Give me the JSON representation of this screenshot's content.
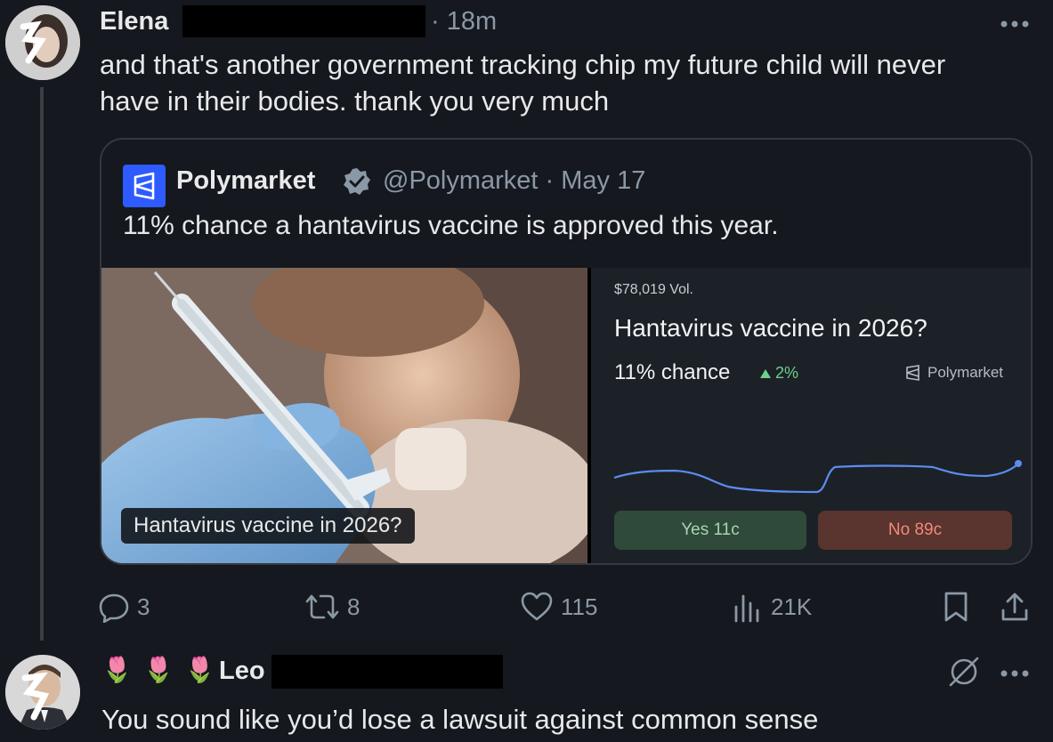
{
  "post": {
    "author": "Elena",
    "time": "18m",
    "text_line1": "and that's another government tracking chip my future child will never",
    "text_line2": "have in their bodies. thank you very much",
    "more_icon": "more-icon"
  },
  "quote": {
    "author": "Polymarket",
    "handle": "@Polymarket",
    "date": "May 17",
    "text": "11% chance a hantavirus vaccine is approved this year.",
    "image_caption": "Hantavirus vaccine in 2026?",
    "market": {
      "volume": "$78,019 Vol.",
      "title": "Hantavirus vaccine in 2026?",
      "chance": "11% chance",
      "delta": "2%",
      "brand": "Polymarket",
      "yes_label": "Yes 11c",
      "no_label": "No 89c"
    }
  },
  "actions": {
    "replies": "3",
    "reposts": "8",
    "likes": "115",
    "views": "21K"
  },
  "reply": {
    "emojis": "🌷 🌷 🌷",
    "author": "Leo",
    "text": "You sound like you’d lose a lawsuit against common sense"
  },
  "colors": {
    "background": "#15181e",
    "text": "#e7e9ea",
    "muted": "#8b98a5",
    "line": "#5b8def",
    "yes": "#2f4a3a",
    "no": "#5a342e",
    "brand": "#2e5bff"
  }
}
